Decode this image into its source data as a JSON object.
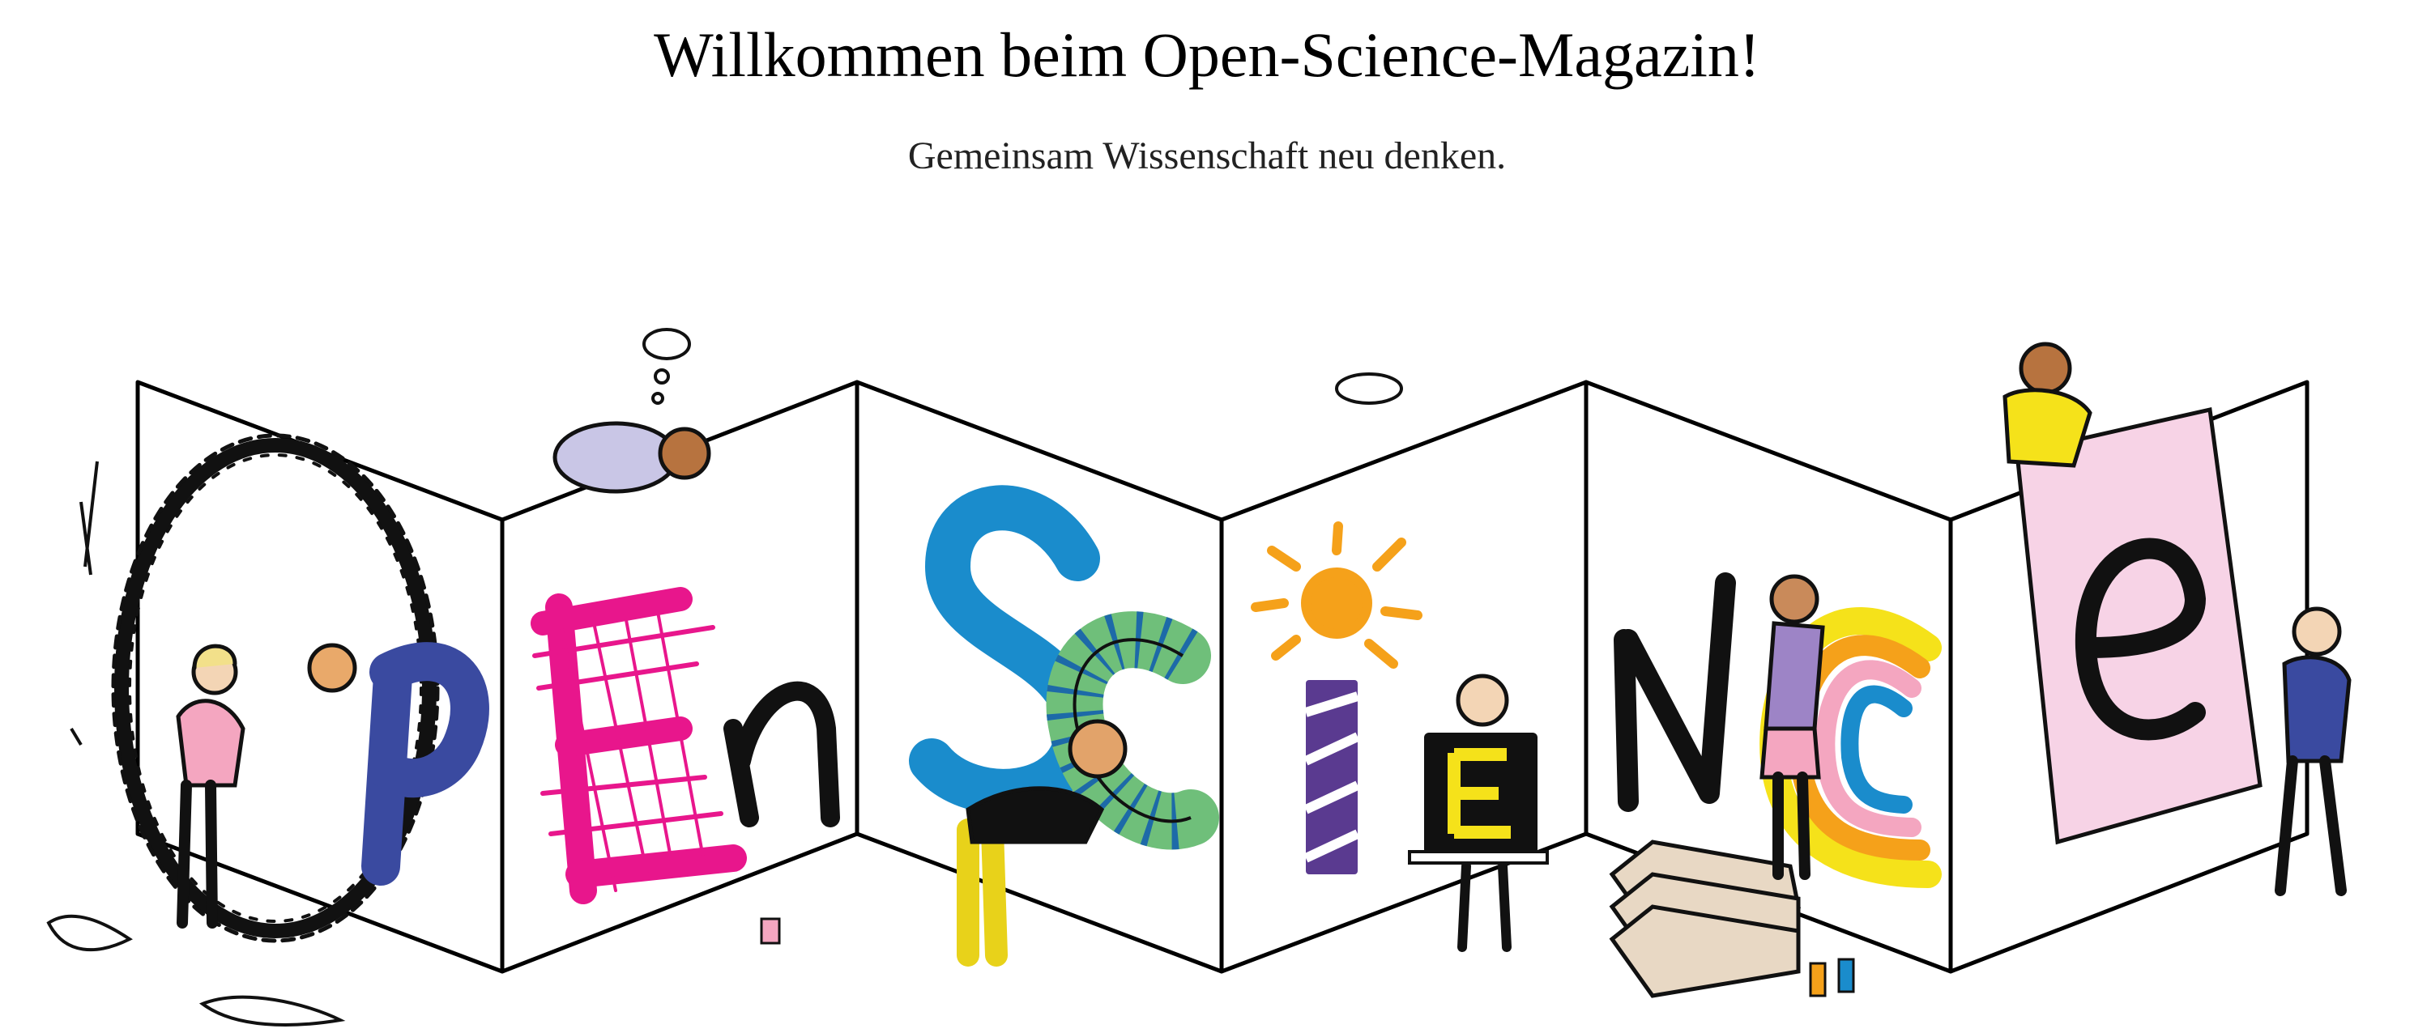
{
  "header": {
    "title": "Willkommen beim Open-Science-Magazin!",
    "subtitle": "Gemeinsam Wissenschaft neu denken."
  },
  "illustration": {
    "letters": [
      "O",
      "P",
      "E",
      "n",
      "S",
      "C",
      "i",
      "E",
      "N",
      "C",
      "e"
    ],
    "colors": {
      "blue": "#3a4aa0",
      "magenta": "#e8168c",
      "cyan": "#1a8ccc",
      "purple": "#5a3a90",
      "yellow": "#f5e21a",
      "orange": "#f5a11a",
      "pink": "#f4a6c0",
      "light_pink": "#f7d3e6",
      "green": "#6fbf7a"
    }
  }
}
